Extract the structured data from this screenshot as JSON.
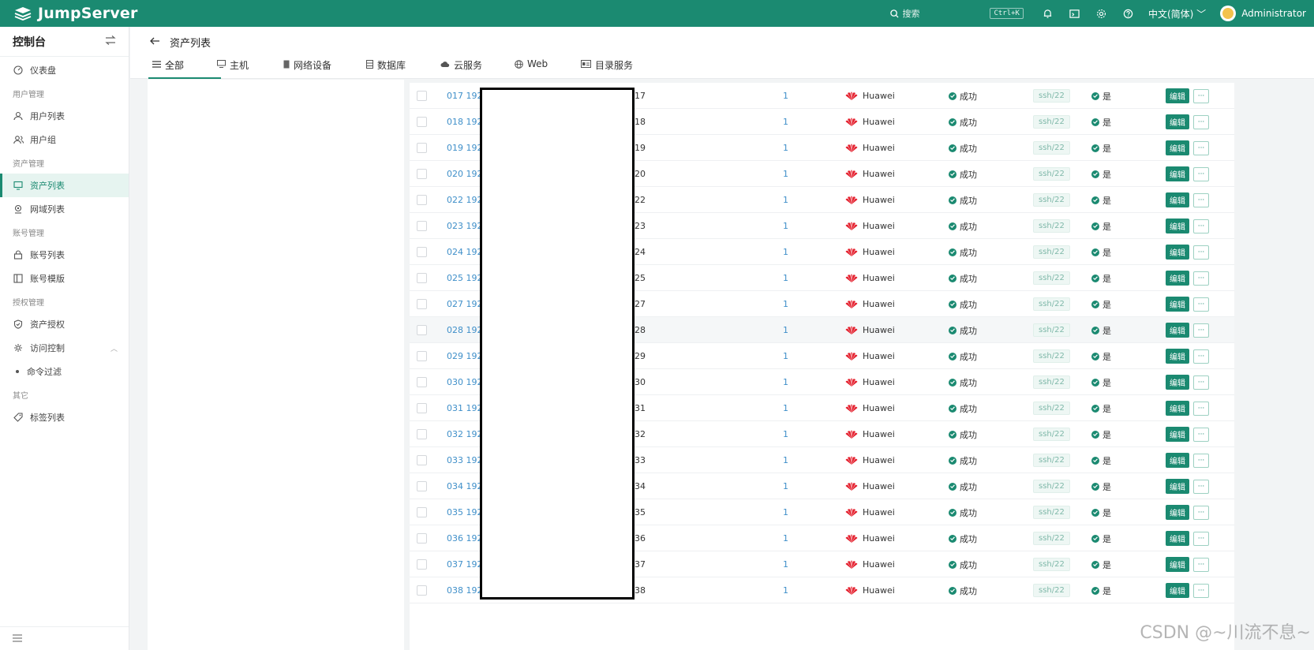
{
  "app": {
    "brand": "JumpServer"
  },
  "topbar": {
    "search_label": "搜索",
    "search_shortcut": "Ctrl+K",
    "language": "中文(简体)",
    "user": "Administrator",
    "accent": "#1b8a71"
  },
  "sidebar": {
    "title": "控制台",
    "dashboard": "仪表盘",
    "groups": {
      "users": "用户管理",
      "assets": "资产管理",
      "accounts": "账号管理",
      "perms": "授权管理",
      "other": "其它"
    },
    "items": {
      "user_list": "用户列表",
      "user_group": "用户组",
      "asset_list": "资产列表",
      "zone_list": "网域列表",
      "account_list": "账号列表",
      "account_template": "账号模版",
      "asset_perm": "资产授权",
      "access_control": "访问控制",
      "command_filter": "命令过滤",
      "label_list": "标签列表"
    }
  },
  "page": {
    "title": "资产列表",
    "tabs": [
      "全部",
      "主机",
      "网络设备",
      "数据库",
      "云服务",
      "Web",
      "目录服务"
    ]
  },
  "table": {
    "vendor": "Huawei",
    "conn_status": "成功",
    "protocol": "ssh/22",
    "active": "是",
    "edit_label": "编辑",
    "more_label": "···",
    "rows": [
      {
        "name": "017 192",
        "addr": "17",
        "accounts": "1"
      },
      {
        "name": "018 192",
        "addr": "18",
        "accounts": "1"
      },
      {
        "name": "019 192",
        "addr": "19",
        "accounts": "1"
      },
      {
        "name": "020 192",
        "addr": "20",
        "accounts": "1"
      },
      {
        "name": "022 192",
        "addr": "22",
        "accounts": "1"
      },
      {
        "name": "023 192",
        "addr": "23",
        "accounts": "1"
      },
      {
        "name": "024 192",
        "addr": "24",
        "accounts": "1"
      },
      {
        "name": "025 192",
        "addr": "25",
        "accounts": "1"
      },
      {
        "name": "027 192",
        "addr": "27",
        "accounts": "1"
      },
      {
        "name": "028 192",
        "addr": "28",
        "accounts": "1"
      },
      {
        "name": "029 192",
        "addr": "29",
        "accounts": "1"
      },
      {
        "name": "030 192",
        "addr": "30",
        "accounts": "1"
      },
      {
        "name": "031 192",
        "addr": "31",
        "accounts": "1"
      },
      {
        "name": "032 192",
        "addr": "32",
        "accounts": "1"
      },
      {
        "name": "033 192",
        "addr": "33",
        "accounts": "1"
      },
      {
        "name": "034 192",
        "addr": "34",
        "accounts": "1"
      },
      {
        "name": "035 192",
        "addr": "35",
        "accounts": "1"
      },
      {
        "name": "036 192",
        "addr": "36",
        "accounts": "1"
      },
      {
        "name": "037 192",
        "addr": "37",
        "accounts": "1"
      },
      {
        "name": "038 192",
        "addr": "38",
        "accounts": "1"
      }
    ]
  },
  "watermark": "CSDN @~川流不息~"
}
